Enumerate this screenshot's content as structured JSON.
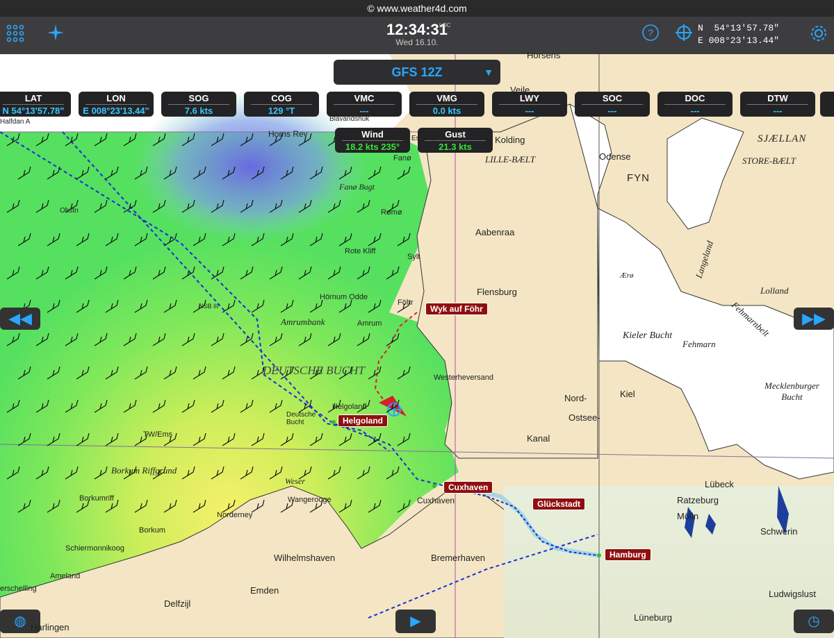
{
  "topbar": {
    "url_text": "© www.weather4d.com"
  },
  "navbar": {
    "time": "12:34:31",
    "loc_label": "LOC",
    "date": "Wed 16.10.",
    "coord_n": "N  54°13'57.78\"",
    "coord_e": "E 008°23'13.44\"",
    "icons": [
      "grid-menu-icon",
      "compass-star-icon",
      "help-icon",
      "crosshair-icon",
      "gear-icon"
    ]
  },
  "model_select": {
    "value": "GFS 12Z"
  },
  "instruments": [
    {
      "label": "LAT",
      "value": "N  54°13'57.78\""
    },
    {
      "label": "LON",
      "value": "E 008°23'13.44\""
    },
    {
      "label": "SOG",
      "value": "7.6 kts"
    },
    {
      "label": "COG",
      "value": "129 °T"
    },
    {
      "label": "VMC",
      "value": "---"
    },
    {
      "label": "VMG",
      "value": "0.0 kts"
    },
    {
      "label": "LWY",
      "value": "---"
    },
    {
      "label": "SOC",
      "value": "---"
    },
    {
      "label": "DOC",
      "value": "---"
    },
    {
      "label": "DTW",
      "value": "---"
    }
  ],
  "wind_boxes": [
    {
      "label": "Wind",
      "value": "18.2 kts 235°"
    },
    {
      "label": "Gust",
      "value": "21.3 kts"
    }
  ],
  "waypoints": [
    "Wyk auf Föhr",
    "Helgoland",
    "Cuxhaven",
    "Glückstadt",
    "Hamburg"
  ],
  "places": {
    "horsens": "Horsens",
    "vejle": "Vejle",
    "kolding": "Kolding",
    "lille_baelt": "LILLE-BÆLT",
    "odense": "Odense",
    "fyn": "FYN",
    "sjaelland": "SJÆLLAN",
    "store_baelt": "STORE-BÆLT",
    "aabenraa": "Aabenraa",
    "flensburg": "Flensburg",
    "langeland": "Langeland",
    "lolland": "Lolland",
    "aero": "Ærø",
    "kieler_bucht": "Kieler Bucht",
    "fehmarn": "Fehmarn",
    "fehmarnbelt": "Fehmarnbelt",
    "mecklenburger_bucht": "Mecklenburger\nBucht",
    "kiel": "Kiel",
    "nord_ostsee_1": "Nord-",
    "nord_ostsee_2": "Ostsee-",
    "kanal": "Kanal",
    "luebeck": "Lübeck",
    "ratzeburg": "Ratzeburg",
    "schwerin": "Schwerin",
    "moelln": "Mölln",
    "ludwigslust": "Ludwigslust",
    "lueneburg": "Lüneburg",
    "bremerhaven": "Bremerhaven",
    "wilhelmshaven": "Wilhelmshaven",
    "emden": "Emden",
    "delfzijl": "Delfzijl",
    "harlingen": "Harlingen",
    "cuxhaven_town": "Cuxhaven",
    "westerheversand": "Westerheversand",
    "amrum": "Amrum",
    "foehr": "Föhr",
    "sylt": "Sylt",
    "romo": "Rømø",
    "fano": "Fanø",
    "fano_bugt": "Fanø Bugt",
    "horns_rev": "Horns Rev",
    "blavandshuk": "Blåvandshuk",
    "esbjerg": "Esbjerg",
    "rote_kliff": "Rote Kliff",
    "hoernum_odde": "Hörnum Odde",
    "amrumbank": "Amrumbank",
    "deutsche_bucht": "DEUTSCHE BUCHT",
    "helgoland_town": "Helgoland",
    "wangerooge": "Wangeroogе",
    "norderney": "Norderney",
    "borkum": "Borkum",
    "borkumriff": "Borkumriff",
    "schiermonnikoog": "Schiermonnikoog",
    "ameland": "Ameland",
    "terschelling": "erschelling",
    "borkum_riffgrund": "Borkum Riffgrund",
    "tw_ems": "TW/Ems",
    "weser": "Weser",
    "halfdan": "Halfdan A",
    "deutsche_bucht_station": "Deutsche\nBucht",
    "obstn": "Obstn",
    "nsb": "NSB III"
  },
  "colors": {
    "land": "#f4e6c4",
    "sea": "#ffffff",
    "accent": "#2aa6ff",
    "route": "#d6202a",
    "track": "#1a2fd0",
    "tag": "#8f0f0f"
  }
}
